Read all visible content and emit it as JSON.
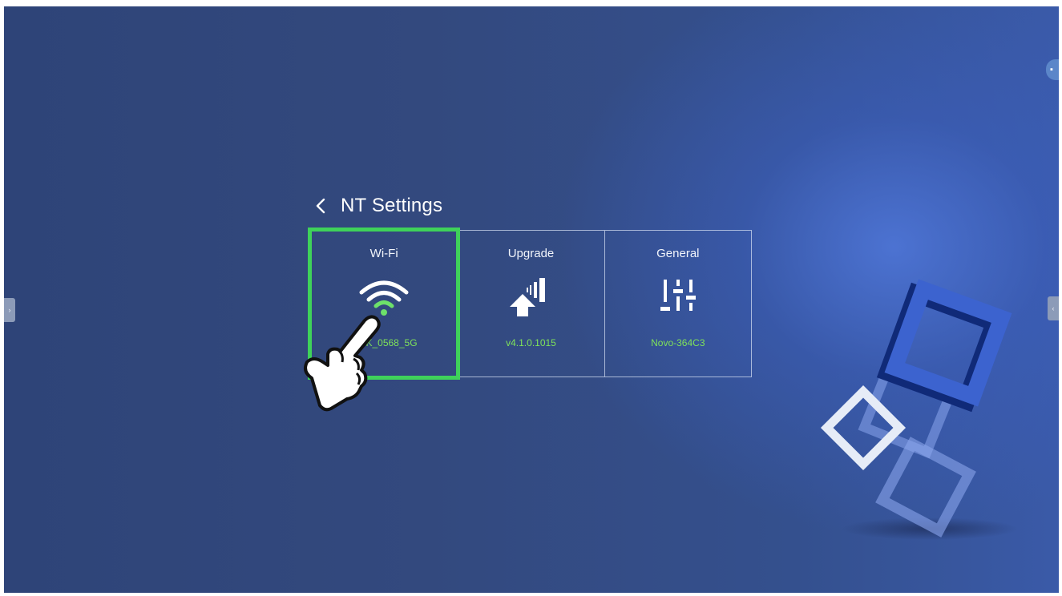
{
  "header": {
    "title": "NT Settings"
  },
  "tiles": [
    {
      "label": "Wi-Fi",
      "value": "LINK_0568_5G",
      "icon": "wifi-icon"
    },
    {
      "label": "Upgrade",
      "value": "v4.1.0.1015",
      "icon": "upgrade-icon"
    },
    {
      "label": "General",
      "value": "Novo-364C3",
      "icon": "sliders-icon"
    }
  ],
  "selected_tile": "Wi-Fi",
  "colors": {
    "accent_green": "#3fd25a",
    "value_green": "#7fe25a",
    "background": "#33497e"
  }
}
